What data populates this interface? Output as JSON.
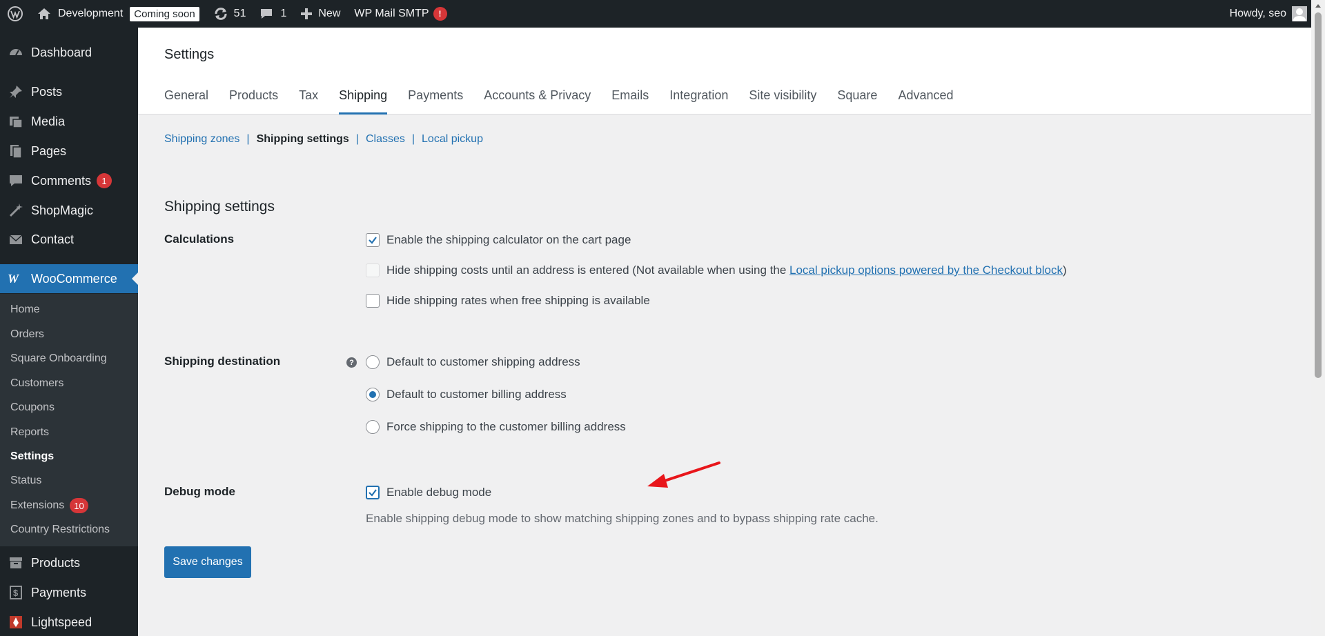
{
  "adminbar": {
    "site_name": "Development",
    "coming_soon": "Coming soon",
    "updates_count": "51",
    "comments_count": "1",
    "new_label": "New",
    "smtp_label": "WP Mail SMTP",
    "smtp_alert": "!",
    "howdy": "Howdy, seo"
  },
  "sidebar": {
    "items": [
      {
        "label": "Dashboard",
        "icon": "dashboard-icon"
      },
      {
        "label": "Posts",
        "icon": "pin-icon"
      },
      {
        "label": "Media",
        "icon": "media-icon"
      },
      {
        "label": "Pages",
        "icon": "pages-icon"
      },
      {
        "label": "Comments",
        "icon": "comment-icon",
        "badge": "1"
      },
      {
        "label": "ShopMagic",
        "icon": "wand-icon"
      },
      {
        "label": "Contact",
        "icon": "mail-icon"
      },
      {
        "label": "WooCommerce",
        "icon": "woo-icon"
      }
    ],
    "woo_submenu": [
      {
        "label": "Home"
      },
      {
        "label": "Orders"
      },
      {
        "label": "Square Onboarding"
      },
      {
        "label": "Customers"
      },
      {
        "label": "Coupons"
      },
      {
        "label": "Reports"
      },
      {
        "label": "Settings"
      },
      {
        "label": "Status"
      },
      {
        "label": "Extensions",
        "badge": "10"
      },
      {
        "label": "Country Restrictions"
      }
    ],
    "bottom_items": [
      {
        "label": "Products",
        "icon": "archive-icon"
      },
      {
        "label": "Payments",
        "icon": "dollar-icon"
      },
      {
        "label": "Lightspeed",
        "icon": "lightspeed-icon"
      }
    ]
  },
  "page": {
    "title": "Settings",
    "tabs": [
      "General",
      "Products",
      "Tax",
      "Shipping",
      "Payments",
      "Accounts & Privacy",
      "Emails",
      "Integration",
      "Site visibility",
      "Square",
      "Advanced"
    ],
    "active_tab": "Shipping",
    "subnav": [
      "Shipping zones",
      "Shipping settings",
      "Classes",
      "Local pickup"
    ],
    "section_title": "Shipping settings",
    "calculations": {
      "label": "Calculations",
      "opt1": "Enable the shipping calculator on the cart page",
      "opt2_prefix": "Hide shipping costs until an address is entered (Not available when using the ",
      "opt2_link": "Local pickup options powered by the Checkout block",
      "opt2_suffix": ")",
      "opt3": "Hide shipping rates when free shipping is available"
    },
    "destination": {
      "label": "Shipping destination",
      "help": "?",
      "opt1": "Default to customer shipping address",
      "opt2": "Default to customer billing address",
      "opt3": "Force shipping to the customer billing address"
    },
    "debug": {
      "label": "Debug mode",
      "opt": "Enable debug mode",
      "description": "Enable shipping debug mode to show matching shipping zones and to bypass shipping rate cache."
    },
    "save_label": "Save changes"
  },
  "colors": {
    "accent": "#2271b1",
    "adminbar_bg": "#1d2327",
    "alert": "#d63638",
    "annotation": "#e8161b"
  }
}
